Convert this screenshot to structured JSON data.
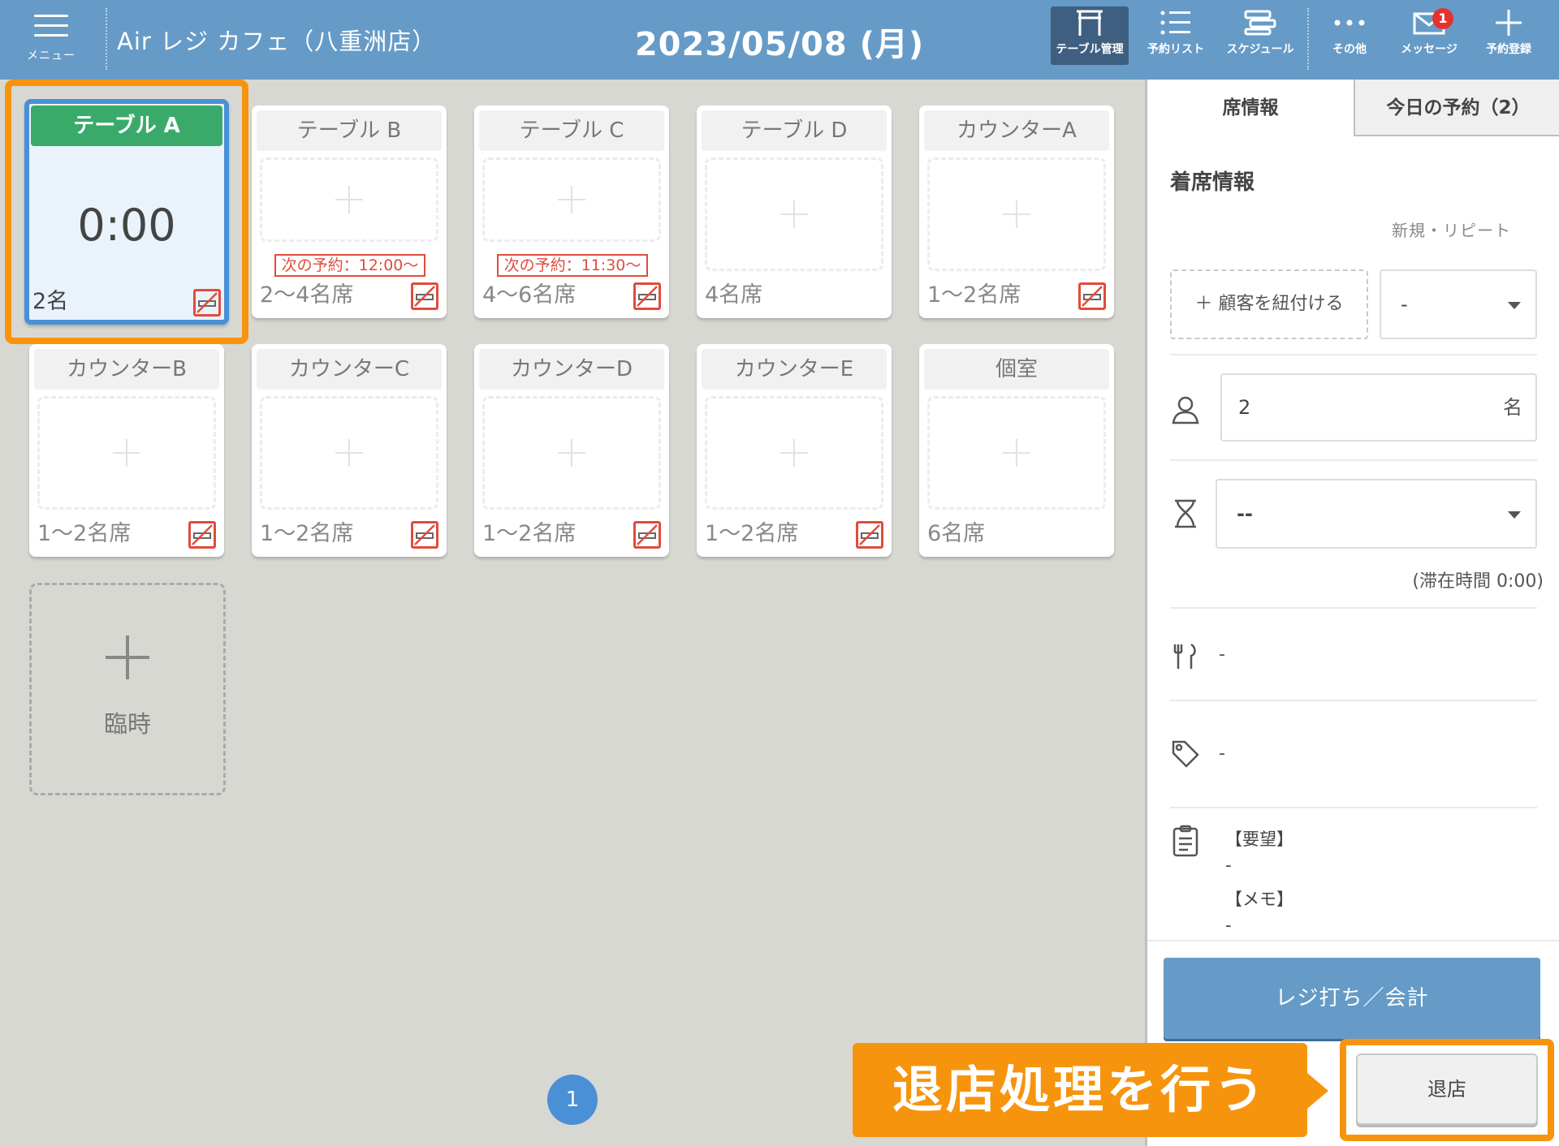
{
  "header": {
    "menu_label": "メニュー",
    "store_name": "Air レジ カフェ（八重洲店）",
    "date": "2023/05/08 (月)",
    "nav": [
      {
        "label": "テーブル管理",
        "icon": "table-icon"
      },
      {
        "label": "予約リスト",
        "icon": "list-icon"
      },
      {
        "label": "スケジュール",
        "icon": "schedule-icon"
      },
      {
        "label": "その他",
        "icon": "more-icon"
      },
      {
        "label": "メッセージ",
        "icon": "mail-icon",
        "badge": "1"
      },
      {
        "label": "予約登録",
        "icon": "plus-icon"
      }
    ]
  },
  "tables": [
    {
      "name": "テーブル A",
      "timer": "0:00",
      "seats": "2名",
      "active": true
    },
    {
      "name": "テーブル B",
      "seats": "2〜4名席",
      "next": "次の予約：12:00〜"
    },
    {
      "name": "テーブル C",
      "seats": "4〜6名席",
      "next": "次の予約：11:30〜"
    },
    {
      "name": "テーブル D",
      "seats": "4名席"
    },
    {
      "name": "カウンターA",
      "seats": "1〜2名席"
    },
    {
      "name": "カウンターB",
      "seats": "1〜2名席"
    },
    {
      "name": "カウンターC",
      "seats": "1〜2名席"
    },
    {
      "name": "カウンターD",
      "seats": "1〜2名席"
    },
    {
      "name": "カウンターE",
      "seats": "1〜2名席"
    },
    {
      "name": "個室",
      "seats": "6名席"
    }
  ],
  "temp_label": "臨時",
  "page": "1",
  "panel": {
    "tabs": [
      "席情報",
      "今日の予約（2）"
    ],
    "section_title": "着席情報",
    "repeat_label": "新規・リピート",
    "link_customer": "＋ 顧客を紐付ける",
    "repeat_value": "-",
    "guests_value": "2",
    "guests_unit": "名",
    "duration_value": "--",
    "stay_time": "(滞在時間 0:00)",
    "course_value": "-",
    "tag_value": "-",
    "request_label": "【要望】",
    "request_value": "-",
    "memo_label": "【メモ】",
    "memo_value": "-",
    "cash_button": "レジ打ち／会計",
    "exit_button": "退店"
  },
  "callout": "退店処理を行う",
  "colors": {
    "header_bg": "#669bc7",
    "active_title": "#3aaa6a",
    "highlight": "#f7940d",
    "no_smoking": "#e14c3c",
    "page_dot": "#4a90d6"
  }
}
